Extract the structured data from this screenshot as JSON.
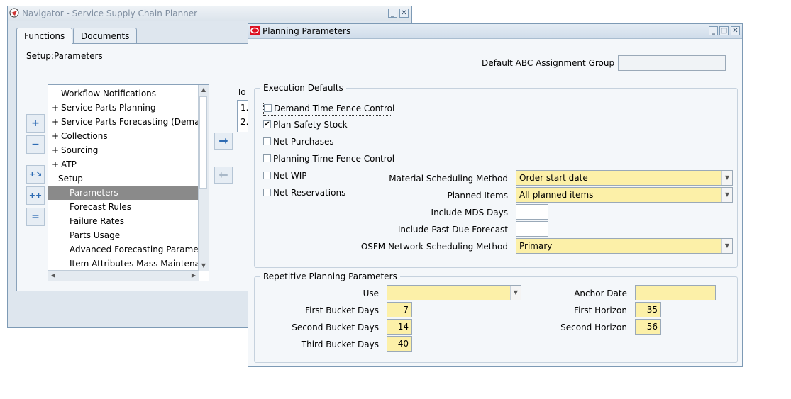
{
  "navigator": {
    "title": "Navigator - Service Supply Chain Planner",
    "tabs": [
      "Functions",
      "Documents"
    ],
    "breadcrumb": "Setup:Parameters",
    "tree_items": [
      {
        "prefix": "",
        "label": "Workflow Notifications"
      },
      {
        "prefix": "+",
        "label": "Service Parts Planning"
      },
      {
        "prefix": "+",
        "label": "Service Parts Forecasting (Dema"
      },
      {
        "prefix": "+",
        "label": "Collections"
      },
      {
        "prefix": "+",
        "label": "Sourcing"
      },
      {
        "prefix": "+",
        "label": "ATP"
      },
      {
        "prefix": "-",
        "label": "Setup"
      },
      {
        "prefix": "",
        "label": "Parameters"
      },
      {
        "prefix": "",
        "label": "Forecast Rules"
      },
      {
        "prefix": "",
        "label": "Failure Rates"
      },
      {
        "prefix": "",
        "label": "Parts Usage"
      },
      {
        "prefix": "",
        "label": "Advanced Forecasting Paramet"
      },
      {
        "prefix": "",
        "label": "Item Attributes Mass Maintenai"
      }
    ],
    "top_label": "To",
    "top_list": [
      "1.",
      "2."
    ]
  },
  "planparams": {
    "title": "Planning Parameters",
    "default_abc_label": "Default ABC Assignment Group",
    "default_abc_value": "",
    "execution": {
      "title": "Execution Defaults",
      "checkboxes": [
        {
          "label": "Demand Time Fence Control",
          "checked": false
        },
        {
          "label": "Plan Safety Stock",
          "checked": true
        },
        {
          "label": "Net Purchases",
          "checked": false
        },
        {
          "label": "Planning Time Fence Control",
          "checked": false
        },
        {
          "label": "Net WIP",
          "checked": false
        },
        {
          "label": "Net Reservations",
          "checked": false
        }
      ],
      "material_scheduling_label": "Material Scheduling Method",
      "material_scheduling_value": "Order start date",
      "planned_items_label": "Planned Items",
      "planned_items_value": "All planned items",
      "mds_days_label": "Include MDS Days",
      "mds_days_value": "",
      "past_due_label": "Include Past Due Forecast",
      "past_due_value": "",
      "osfm_label": "OSFM Network Scheduling Method",
      "osfm_value": "Primary"
    },
    "repetitive": {
      "title": "Repetitive Planning Parameters",
      "use_label": "Use",
      "use_value": "",
      "first_bucket_label": "First Bucket Days",
      "first_bucket_value": "7",
      "second_bucket_label": "Second Bucket Days",
      "second_bucket_value": "14",
      "third_bucket_label": "Third Bucket Days",
      "third_bucket_value": "40",
      "anchor_date_label": "Anchor Date",
      "anchor_date_value": "",
      "first_horizon_label": "First Horizon",
      "first_horizon_value": "35",
      "second_horizon_label": "Second Horizon",
      "second_horizon_value": "56"
    }
  }
}
